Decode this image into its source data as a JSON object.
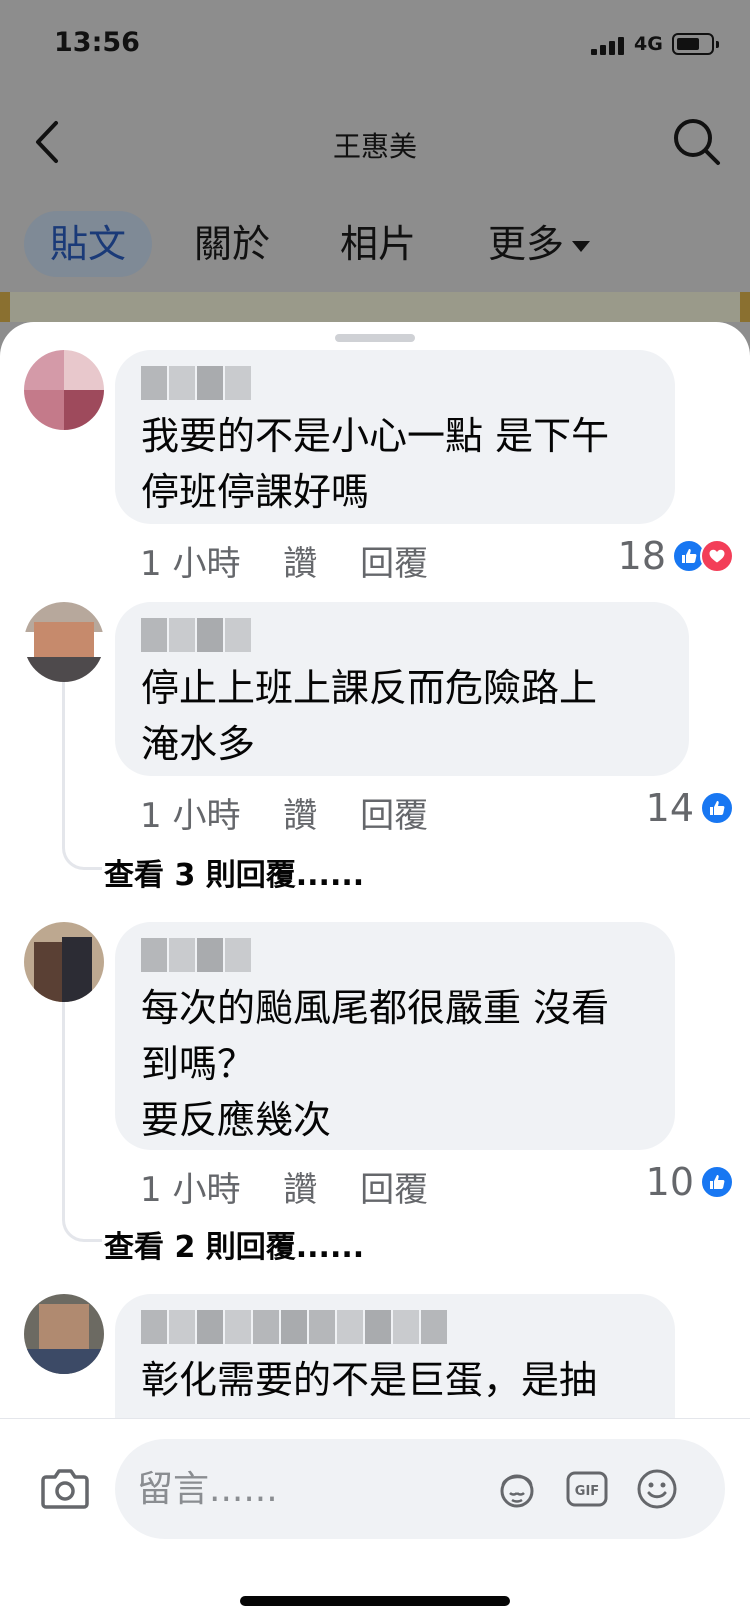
{
  "status_bar": {
    "time": "13:56",
    "network": "4G"
  },
  "header": {
    "title": "王惠美"
  },
  "tabs": [
    {
      "label": "貼文",
      "active": true
    },
    {
      "label": "關於",
      "active": false
    },
    {
      "label": "相片",
      "active": false
    },
    {
      "label": "更多",
      "active": false
    }
  ],
  "comments": [
    {
      "text": "我要的不是小心一點 是下午\n停班停課好嗎",
      "time": "1 小時",
      "like_label": "讚",
      "reply_label": "回覆",
      "reaction_count": "18",
      "reactions": [
        "like",
        "love"
      ]
    },
    {
      "text": "停止上班上課反而危險路上\n淹水多",
      "time": "1 小時",
      "like_label": "讚",
      "reply_label": "回覆",
      "reaction_count": "14",
      "reactions": [
        "like"
      ],
      "view_replies": "查看 3 則回覆......"
    },
    {
      "text": "每次的颱風尾都很嚴重 沒看\n到嗎？\n要反應幾次",
      "time": "1 小時",
      "like_label": "讚",
      "reply_label": "回覆",
      "reaction_count": "10",
      "reactions": [
        "like"
      ],
      "view_replies": "查看 2 則回覆......"
    },
    {
      "text": "彰化需要的不是巨蛋，是抽"
    }
  ],
  "composer": {
    "placeholder": "留言......",
    "gif_label": "GIF"
  },
  "colors": {
    "like": "#1877f2",
    "love": "#f33e58",
    "bubble": "#f0f2f5",
    "meta": "#65676b"
  },
  "icons": [
    "back-arrow-icon",
    "search-icon",
    "camera-icon",
    "avatar-sticker-icon",
    "gif-icon",
    "emoji-icon",
    "like-icon",
    "love-icon"
  ]
}
